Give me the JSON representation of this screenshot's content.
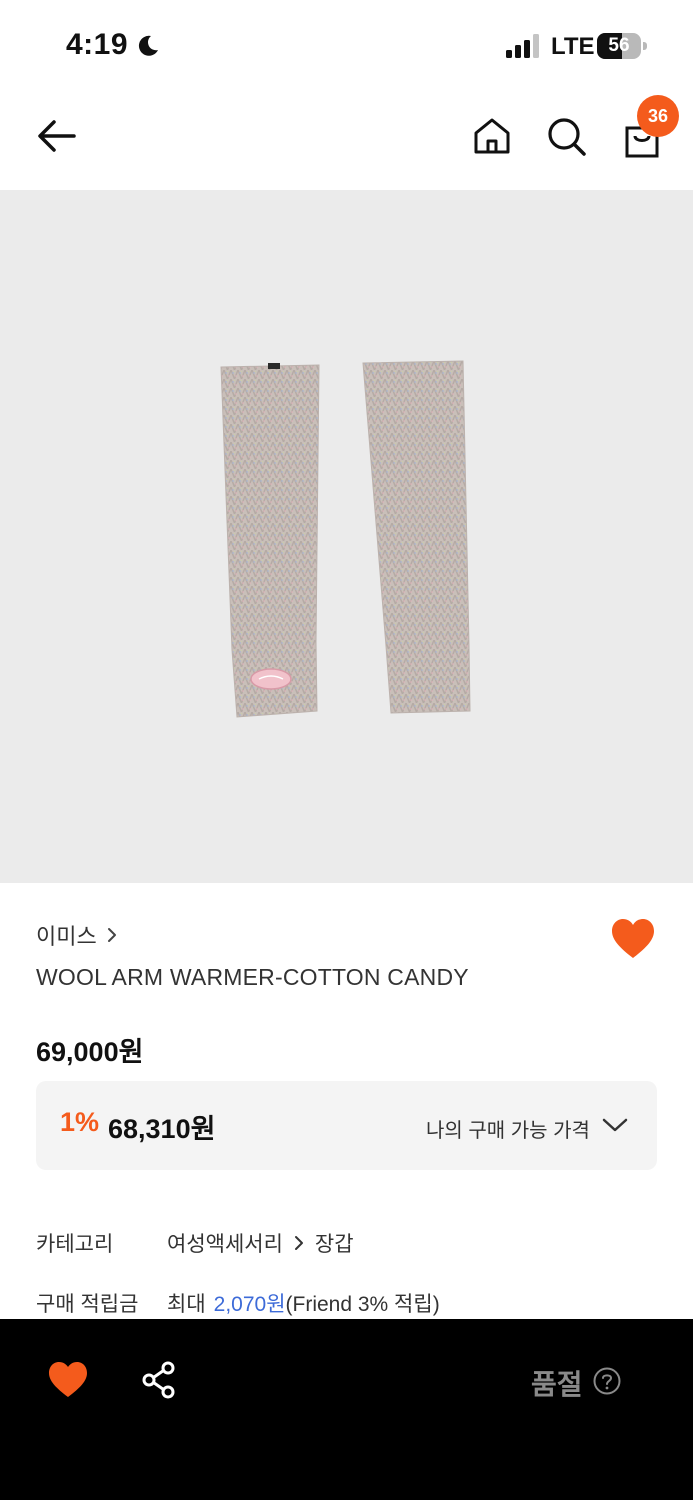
{
  "status_bar": {
    "time": "4:19",
    "network": "LTE",
    "battery": "56",
    "battery_level": 0.56
  },
  "header": {
    "cart_count": "36",
    "icons": [
      "back-arrow-icon",
      "home-icon",
      "search-icon",
      "shopping-bag-icon"
    ]
  },
  "product": {
    "brand": "이미스",
    "title": "WOOL ARM WARMER-COTTON CANDY",
    "price": "69,000원",
    "discount_rate": "1%",
    "discounted_price": "68,310원",
    "my_price_label": "나의 구매 가능 가격"
  },
  "details": {
    "category_label": "카테고리",
    "category_main": "여성액세서리",
    "category_sub": "장갑",
    "points_label": "구매 적립금",
    "points_prefix": "최대",
    "points_amount": "2,070원",
    "points_suffix": "(Friend 3% 적립)"
  },
  "bottom_bar": {
    "status_label": "품절"
  },
  "colors": {
    "accent": "#f45b1c",
    "link_blue": "#3d6bd8",
    "image_bg": "#ebebeb",
    "bottom_bar_bg": "#000000"
  }
}
